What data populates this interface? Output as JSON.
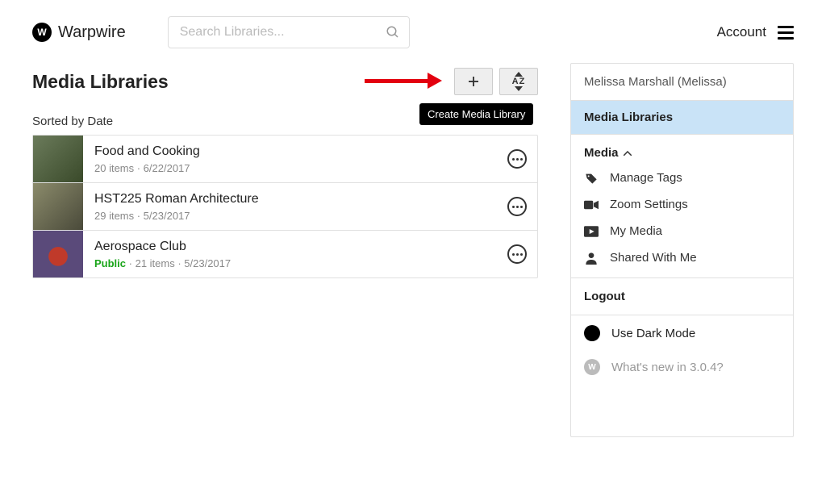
{
  "brand": "Warpwire",
  "search": {
    "placeholder": "Search Libraries..."
  },
  "account": {
    "label": "Account"
  },
  "main": {
    "title": "Media Libraries",
    "sorted_by": "Sorted by Date",
    "tooltip": "Create Media Library",
    "sort_button_label": "AZ",
    "libraries": [
      {
        "title": "Food and Cooking",
        "meta": "20 items · 6/22/2017",
        "public": false
      },
      {
        "title": "HST225 Roman Architecture",
        "meta": "29 items · 5/23/2017",
        "public": false
      },
      {
        "title": "Aerospace Club",
        "meta": "21 items · 5/23/2017",
        "public": true
      }
    ],
    "public_label": "Public"
  },
  "sidebar": {
    "user": "Melissa Marshall (Melissa)",
    "active": "Media Libraries",
    "media_head": "Media",
    "items": [
      {
        "label": "Manage Tags",
        "icon": "tag-icon"
      },
      {
        "label": "Zoom Settings",
        "icon": "video-icon"
      },
      {
        "label": "My Media",
        "icon": "play-icon"
      },
      {
        "label": "Shared With Me",
        "icon": "person-icon"
      }
    ],
    "logout": "Logout",
    "dark_mode": "Use Dark Mode",
    "whatsnew": "What's new in 3.0.4?"
  }
}
